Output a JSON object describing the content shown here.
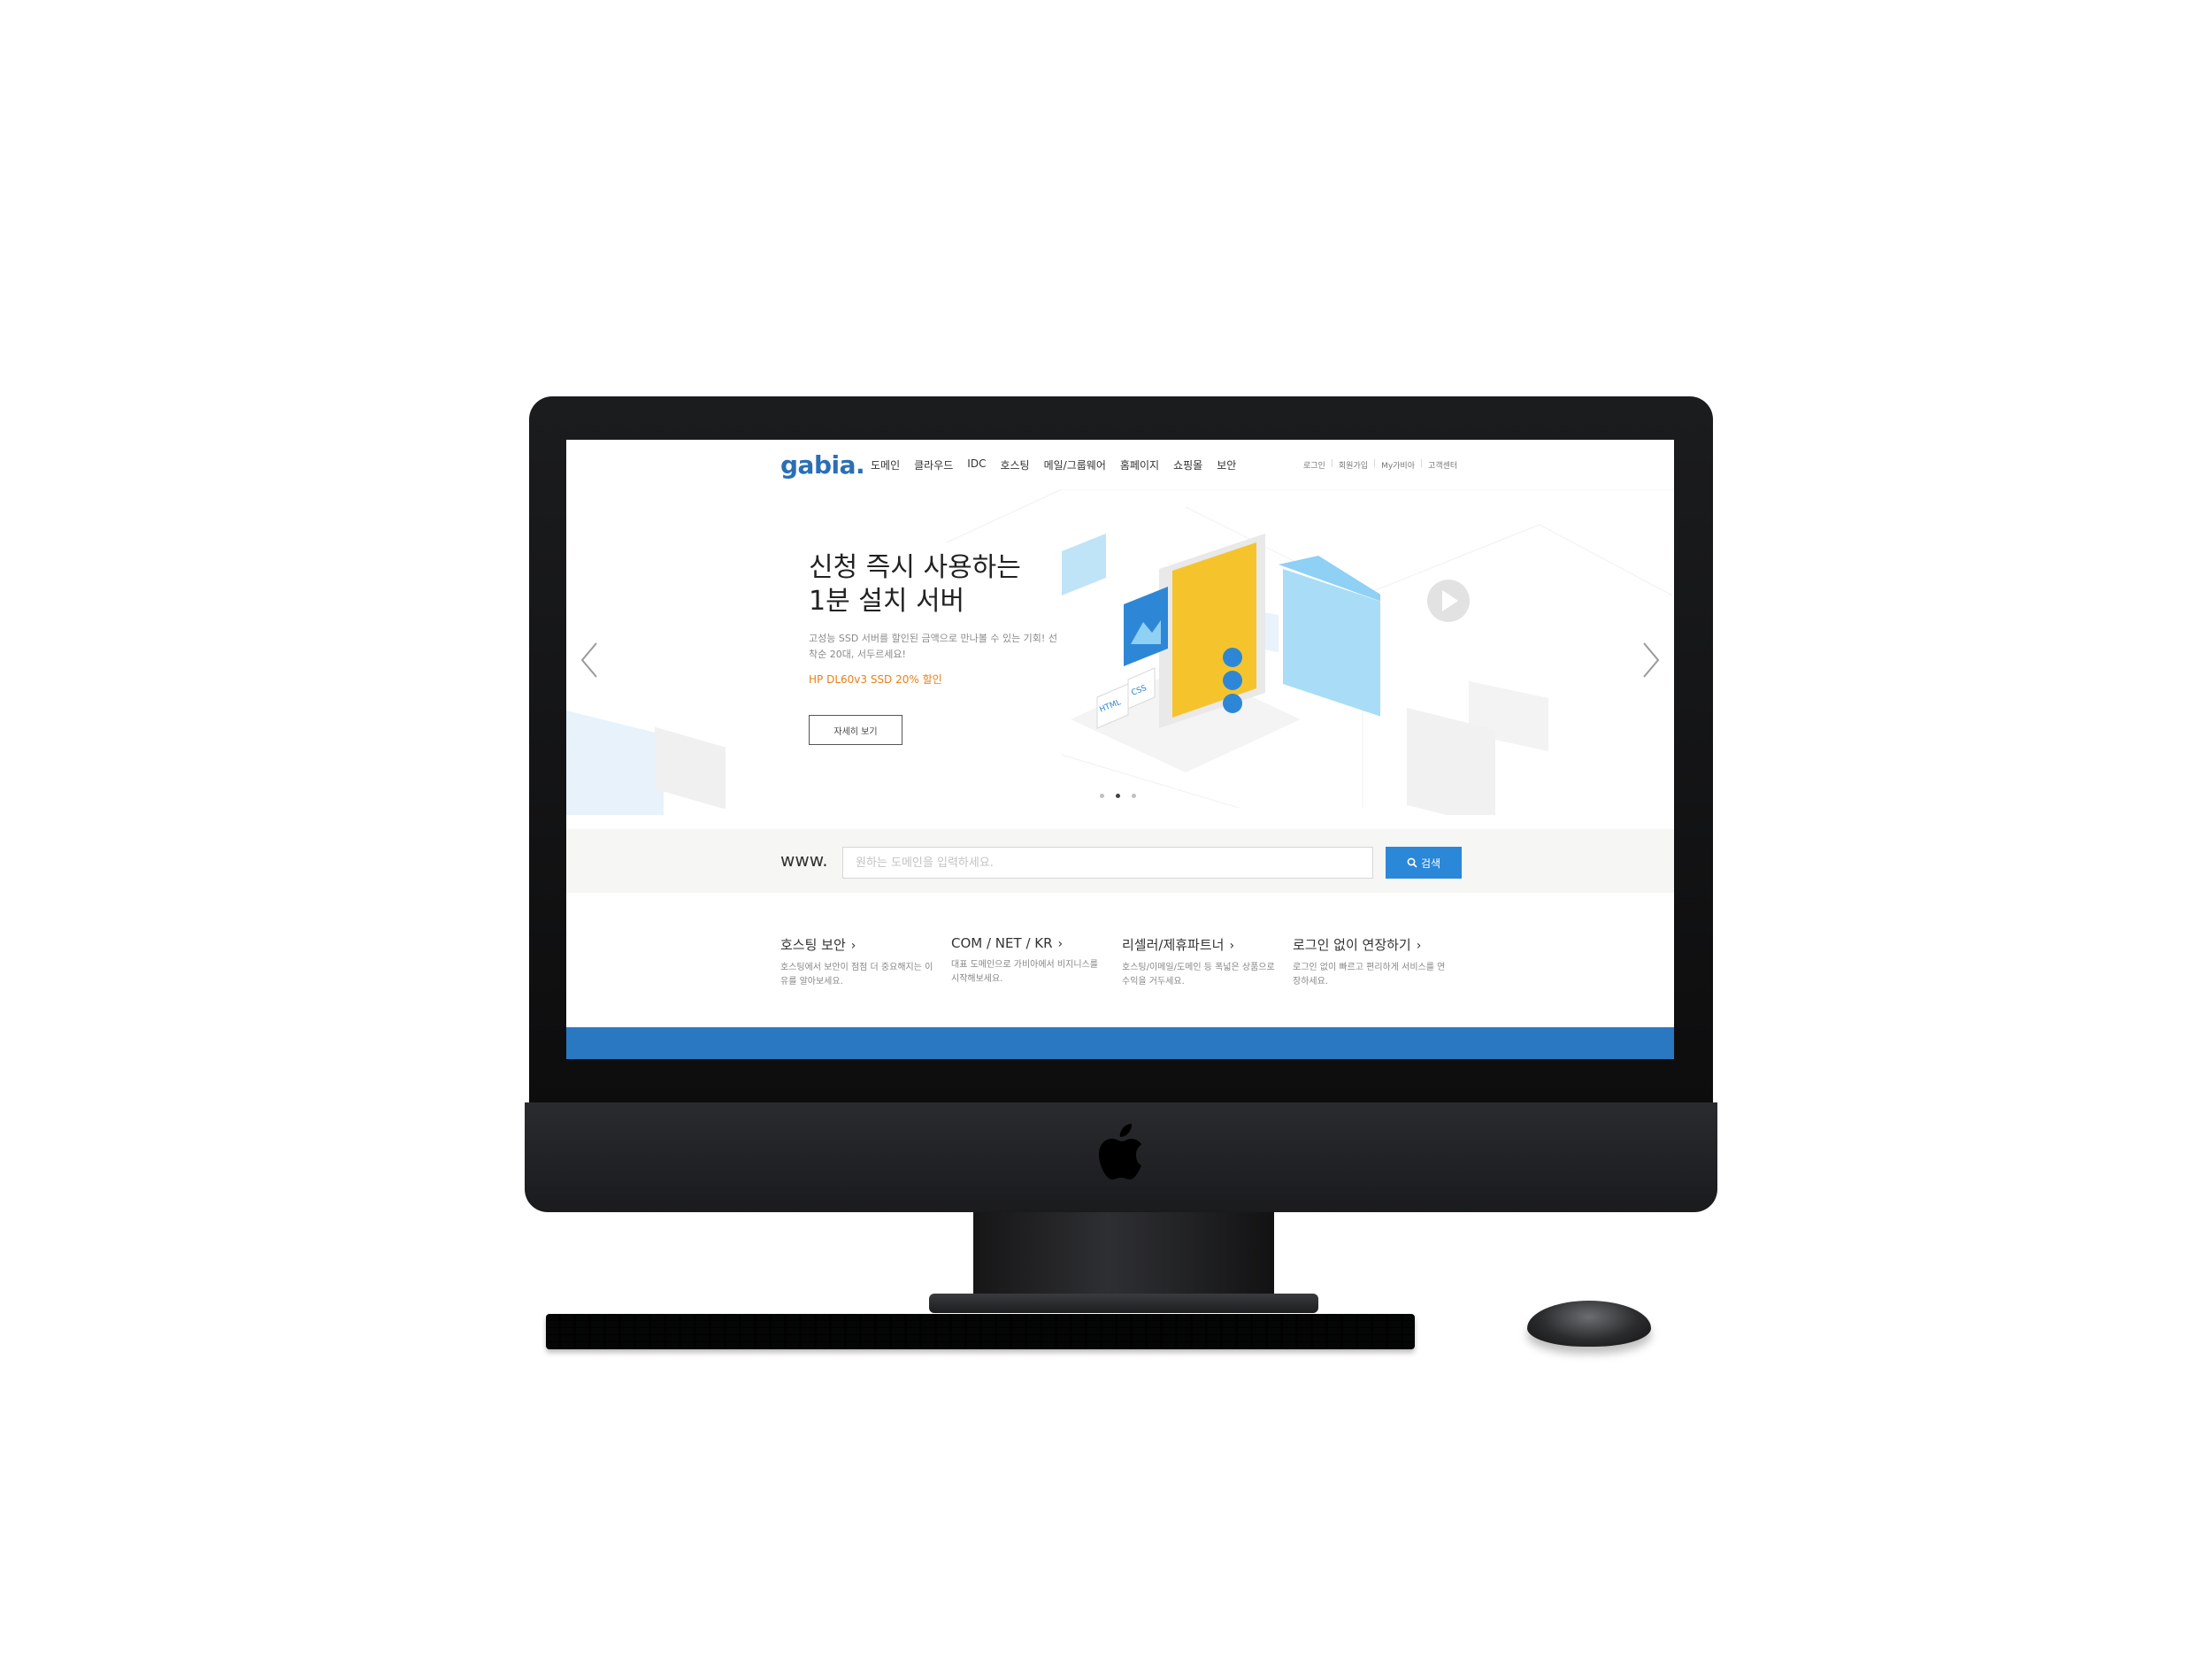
{
  "header": {
    "logo": "gabia.",
    "menu": [
      {
        "label": "도메인"
      },
      {
        "label": "클라우드"
      },
      {
        "label": "IDC"
      },
      {
        "label": "호스팅"
      },
      {
        "label": "메일/그룹웨어"
      },
      {
        "label": "홈페이지"
      },
      {
        "label": "쇼핑몰"
      },
      {
        "label": "보안"
      }
    ],
    "util": [
      "로그인",
      "회원가입",
      "My가비아",
      "고객센터"
    ]
  },
  "hero": {
    "title": "신청 즉시 사용하는\n1분 설치 서버",
    "subtitle": "고성능 SSD 서버를 할인된 금액으로 만나볼 수 있는 기회! 선착순 20대, 서두르세요!",
    "promo": "HP DL60v3 SSD 20% 할인",
    "button": "자세히 보기",
    "slides_total": 3,
    "active_slide": 2,
    "illustration_labels": {
      "html": "HTML",
      "css": "CSS"
    }
  },
  "search": {
    "prefix": "www.",
    "placeholder": "원하는 도메인을 입력하세요.",
    "button": "검색"
  },
  "links": [
    {
      "title": "호스팅 보안",
      "desc": "호스팅에서 보안이 점점 더 중요해지는 이유를 알아보세요."
    },
    {
      "title": "COM / NET / KR",
      "desc": "대표 도메인으로 가비아에서 비지니스를 시작해보세요."
    },
    {
      "title": "리셀러/제휴파트너",
      "desc": "호스팅/이메일/도메인 등 폭넓은 상품으로 수익을 거두세요."
    },
    {
      "title": "로그인 없이 연장하기",
      "desc": "로그인 없이 빠르고 편리하게 서비스를 연장하세요."
    }
  ],
  "colors": {
    "brand": "#2a6fb6",
    "search_button": "#2b87d8",
    "promo": "#e8801a",
    "bottom_bar": "#2a78c2",
    "illustration_yellow": "#f5c42c",
    "illustration_blue": "#8fd0f5"
  },
  "icons": [
    "apple-logo-icon",
    "search-icon",
    "chevron-left-icon",
    "chevron-right-icon",
    "chevron-right-small-icon"
  ]
}
